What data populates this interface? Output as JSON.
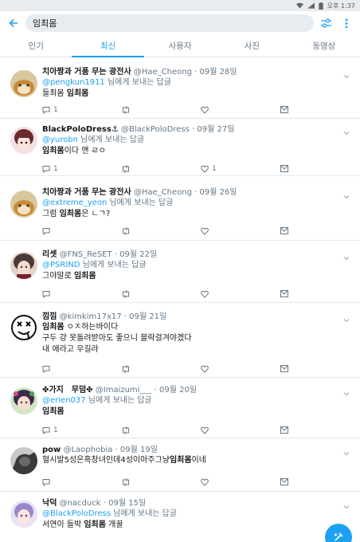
{
  "status_bar": {
    "time": "오후 1:37"
  },
  "search": {
    "value": "임최몸"
  },
  "tabs": [
    {
      "label": "인기",
      "active": false
    },
    {
      "label": "최신",
      "active": true
    },
    {
      "label": "사용자",
      "active": false
    },
    {
      "label": "사진",
      "active": false
    },
    {
      "label": "동영상",
      "active": false
    }
  ],
  "tweets": [
    {
      "display_name": "치아짱과 거품 무는 광전사",
      "handle": "@Hae_Cheong",
      "time": "· 09월 28일",
      "reply_to": "@pengkun1911",
      "reply_suffix": " 님에게 보내는 답글",
      "text_lines": [
        {
          "pre": "들최몸 ",
          "bold": "임최몸",
          "post": ""
        }
      ],
      "reply_count": "1",
      "retweet_count": "",
      "like_count": ""
    },
    {
      "display_name": "BlackPoloDress⚓",
      "handle": "@BlackPoloDress",
      "time": "· 09월 27일",
      "reply_to": "@yurobn",
      "reply_suffix": " 님에게 보내는 답글",
      "text_lines": [
        {
          "pre": "",
          "bold": "임최몸",
          "post": "이다 앤 ㄹㅇ"
        }
      ],
      "reply_count": "1",
      "retweet_count": "",
      "like_count": "1"
    },
    {
      "display_name": "치아짱과 거품 무는 광전사",
      "handle": "@Hae_Cheong",
      "time": "· 09월 26일",
      "reply_to": "@extreme_yeon",
      "reply_suffix": " 님에게 보내는 답글",
      "text_lines": [
        {
          "pre": "그럼 ",
          "bold": "임최몸",
          "post": "은 ㄴㄱ?"
        }
      ],
      "reply_count": "",
      "retweet_count": "",
      "like_count": ""
    },
    {
      "display_name": "리셋",
      "handle": "@FNS_ReSET",
      "time": "· 09월 22일",
      "reply_to": "@PSRIND",
      "reply_suffix": " 님에게 보내는 답글",
      "text_lines": [
        {
          "pre": "그야말로 ",
          "bold": "임최몸",
          "post": ""
        }
      ],
      "reply_count": "",
      "retweet_count": "",
      "like_count": ""
    },
    {
      "display_name": "낌낌",
      "handle": "@kimkim17x17",
      "time": "· 09월 21일",
      "reply_to": "",
      "reply_suffix": "",
      "text_lines": [
        {
          "pre": "",
          "bold": "임최몸",
          "post": " ㅇㅈ하는바이다"
        },
        {
          "pre": "구두 걍 못돌려받아도 좋으니 블락걸겨야겠다",
          "bold": "",
          "post": ""
        },
        {
          "pre": "내 애라고 우길라",
          "bold": "",
          "post": ""
        }
      ],
      "reply_count": "",
      "retweet_count": "",
      "like_count": ""
    },
    {
      "display_name": "✤가지　무덤✤",
      "handle": "@Imaizumi___",
      "time": "· 09월 20일",
      "reply_to": "@erien037",
      "reply_suffix": " 님에게 보내는 답글",
      "text_lines": [
        {
          "pre": "",
          "bold": "임최몸",
          "post": ""
        }
      ],
      "reply_count": "1",
      "retweet_count": "",
      "like_count": ""
    },
    {
      "display_name": "pow",
      "handle": "@Laophobia",
      "time": "· 09월 19일",
      "reply_to": "",
      "reply_suffix": "",
      "text_lines": [
        {
          "pre": "혈시발5성은흑창녀인데4성이아주그냥",
          "bold": "임최몸",
          "post": "이네"
        }
      ],
      "reply_count": "",
      "retweet_count": "",
      "like_count": ""
    },
    {
      "display_name": "낙덕",
      "handle": "@nacduck",
      "time": "· 09월 15일",
      "reply_to": "@BlackPoloDress",
      "reply_suffix": " 님에게 보내는 답글",
      "text_lines": [
        {
          "pre": "서연이 들박 ",
          "bold": "임최몸",
          "post": " 개꿀"
        }
      ],
      "reply_count": "",
      "retweet_count": "",
      "like_count": ""
    }
  ],
  "colors": {
    "accent": "#1da1f2",
    "secondary_text": "#657786",
    "divider": "#e1e8ed"
  }
}
